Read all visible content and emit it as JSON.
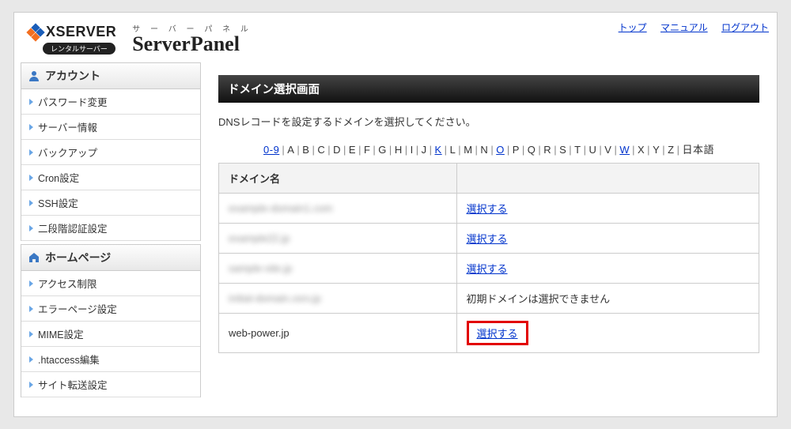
{
  "topLinks": {
    "top": "トップ",
    "manual": "マニュアル",
    "logout": "ログアウト"
  },
  "brand": {
    "xserver": "XSERVER",
    "rental": "レンタルサーバー",
    "kana": "サ ー バ ー パ ネ ル",
    "panel": "ServerPanel"
  },
  "sidebar": {
    "sections": [
      {
        "heading": "アカウント",
        "icon": "person",
        "items": [
          "パスワード変更",
          "サーバー情報",
          "バックアップ",
          "Cron設定",
          "SSH設定",
          "二段階認証設定"
        ]
      },
      {
        "heading": "ホームページ",
        "icon": "home",
        "items": [
          "アクセス制限",
          "エラーページ設定",
          "MIME設定",
          ".htaccess編集",
          "サイト転送設定"
        ]
      }
    ]
  },
  "main": {
    "title": "ドメイン選択画面",
    "description": "DNSレコードを設定するドメインを選択してください。",
    "alpha": [
      {
        "label": "0-9",
        "link": true
      },
      {
        "label": "A"
      },
      {
        "label": "B"
      },
      {
        "label": "C"
      },
      {
        "label": "D"
      },
      {
        "label": "E"
      },
      {
        "label": "F"
      },
      {
        "label": "G"
      },
      {
        "label": "H"
      },
      {
        "label": "I"
      },
      {
        "label": "J"
      },
      {
        "label": "K",
        "link": true
      },
      {
        "label": "L"
      },
      {
        "label": "M"
      },
      {
        "label": "N"
      },
      {
        "label": "O",
        "link": true
      },
      {
        "label": "P"
      },
      {
        "label": "Q"
      },
      {
        "label": "R"
      },
      {
        "label": "S"
      },
      {
        "label": "T"
      },
      {
        "label": "U"
      },
      {
        "label": "V"
      },
      {
        "label": "W",
        "link": true
      },
      {
        "label": "X"
      },
      {
        "label": "Y"
      },
      {
        "label": "Z"
      },
      {
        "label": "日本語"
      }
    ],
    "tableHeader": "ドメイン名",
    "selectLabel": "選択する",
    "rows": [
      {
        "name": "example-domain1.com",
        "blurred": true,
        "action": "link"
      },
      {
        "name": "example22.jp",
        "blurred": true,
        "action": "link"
      },
      {
        "name": "sample-site.jp",
        "blurred": true,
        "action": "link"
      },
      {
        "name": "initial-domain.xsrv.jp",
        "blurred": true,
        "action": "text",
        "text": "初期ドメインは選択できません"
      },
      {
        "name": "web-power.jp",
        "blurred": false,
        "action": "link",
        "highlight": true
      }
    ]
  }
}
